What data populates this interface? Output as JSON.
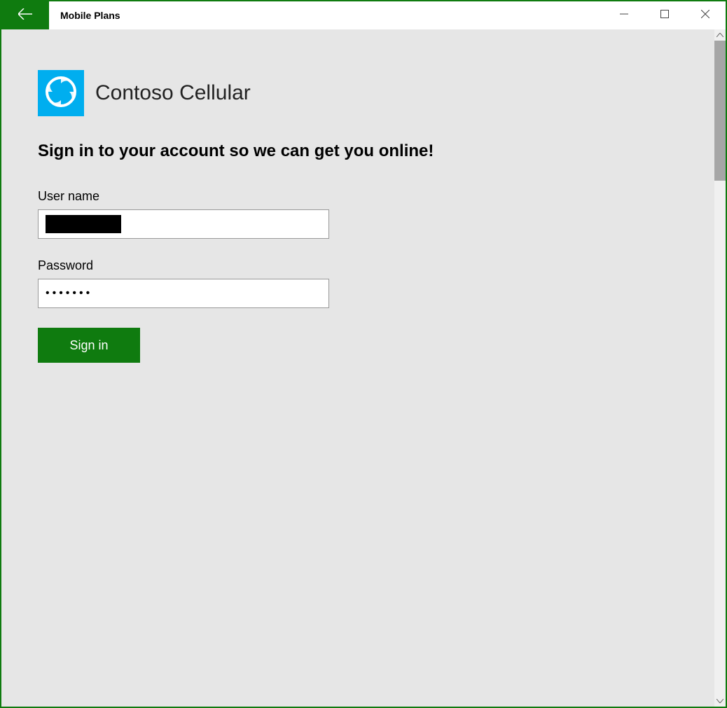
{
  "titlebar": {
    "back_icon": "back-arrow",
    "app_title": "Mobile Plans"
  },
  "window_controls": {
    "minimize": "minimize",
    "maximize": "maximize",
    "close": "close"
  },
  "brand": {
    "logo_icon": "swirl-logo",
    "name": "Contoso Cellular"
  },
  "headline": "Sign in to your account so we can get you online!",
  "form": {
    "username_label": "User name",
    "username_value": "",
    "password_label": "Password",
    "password_value": "•••••••",
    "signin_label": "Sign in"
  },
  "colors": {
    "accent_green": "#0f7b0f",
    "logo_blue": "#00aeef",
    "content_bg": "#e6e6e6"
  }
}
